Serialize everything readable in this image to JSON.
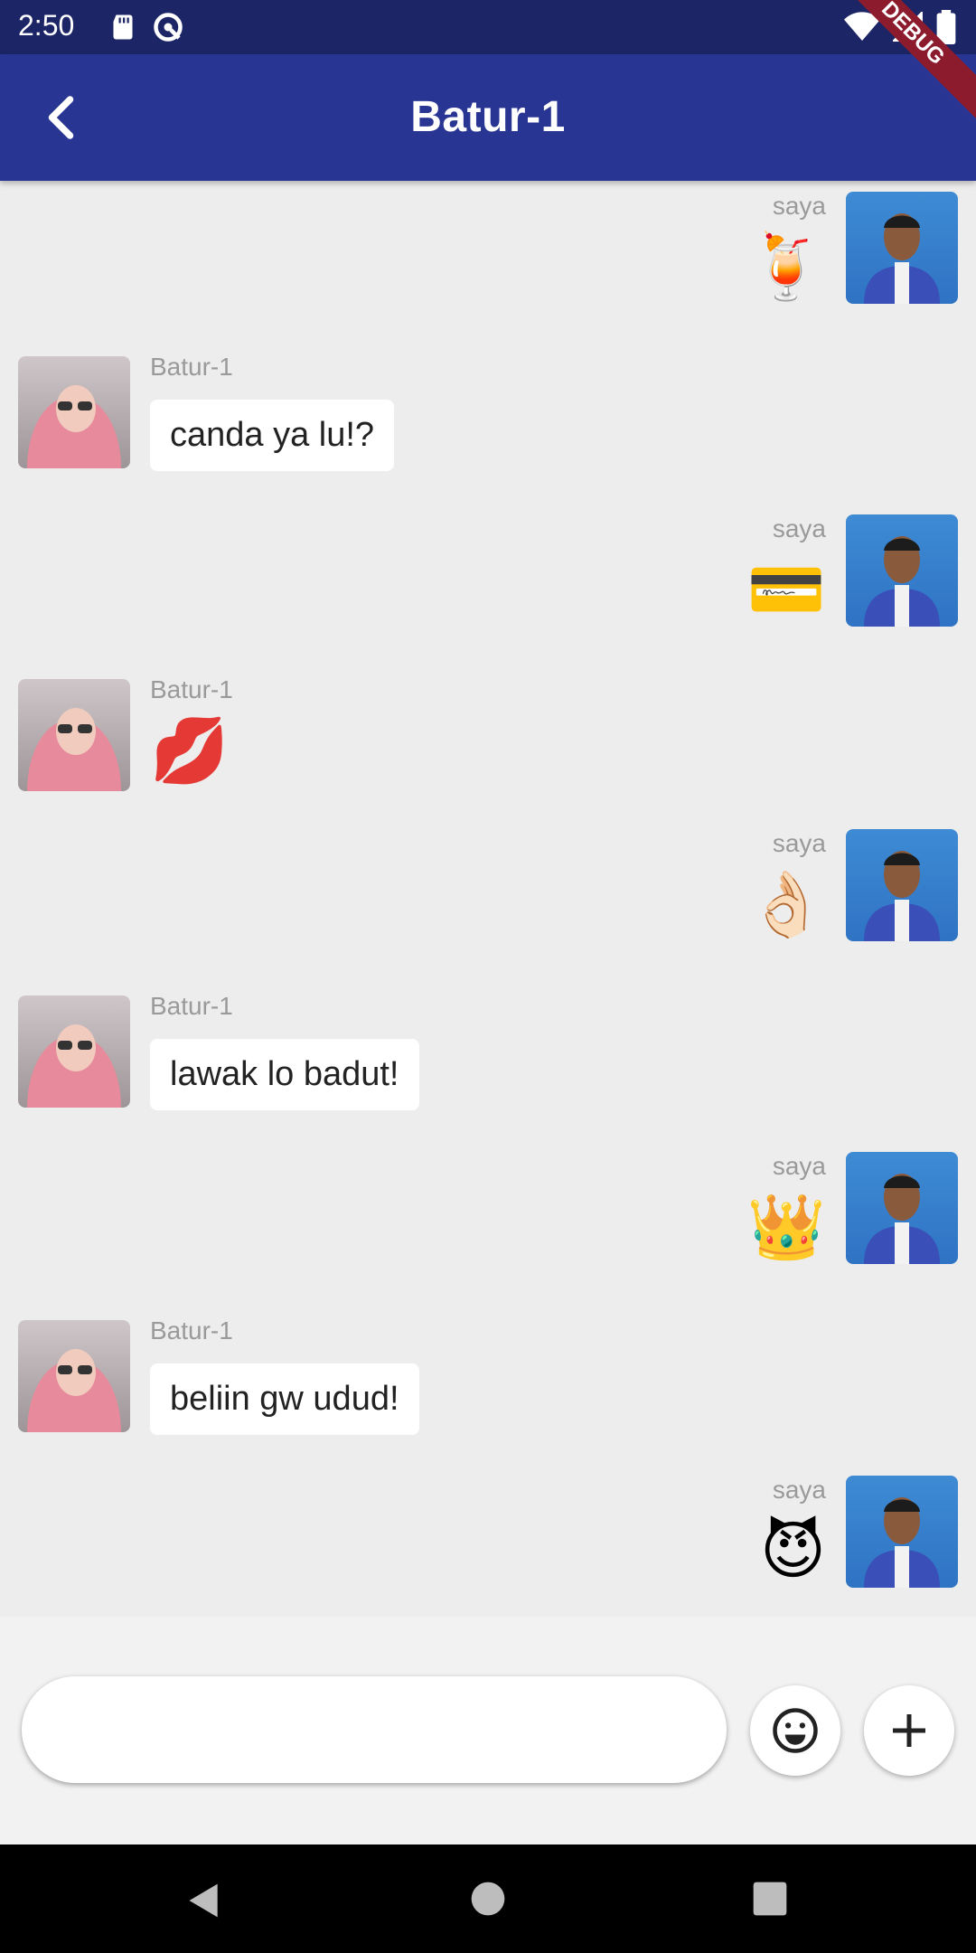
{
  "status_bar": {
    "time": "2:50"
  },
  "app_bar": {
    "title": "Batur-1",
    "debug_label": "DEBUG"
  },
  "messages": [
    {
      "sender": "saya",
      "type": "emoji",
      "content": "🍹"
    },
    {
      "sender": "Batur-1",
      "type": "text",
      "content": "canda ya lu!?"
    },
    {
      "sender": "saya",
      "type": "emoji",
      "content": "💳"
    },
    {
      "sender": "Batur-1",
      "type": "emoji",
      "content": "💋"
    },
    {
      "sender": "saya",
      "type": "emoji",
      "content": "👌🏻"
    },
    {
      "sender": "Batur-1",
      "type": "text",
      "content": "lawak lo badut!"
    },
    {
      "sender": "saya",
      "type": "emoji",
      "content": "👑"
    },
    {
      "sender": "Batur-1",
      "type": "text",
      "content": "beliin gw udud!"
    },
    {
      "sender": "saya",
      "type": "emoji",
      "content": "😈"
    }
  ],
  "composer": {
    "value": "",
    "placeholder": ""
  },
  "icons": {
    "back": "arrow-back-icon",
    "emoji": "smiley-icon",
    "add": "plus-icon",
    "nav_back": "triangle-back-icon",
    "nav_home": "circle-home-icon",
    "nav_recent": "square-recent-icon"
  },
  "colors": {
    "app_bar": "#283593",
    "status_bar": "#1c2666",
    "chat_bg": "#ededed",
    "bubble": "#ffffff"
  }
}
